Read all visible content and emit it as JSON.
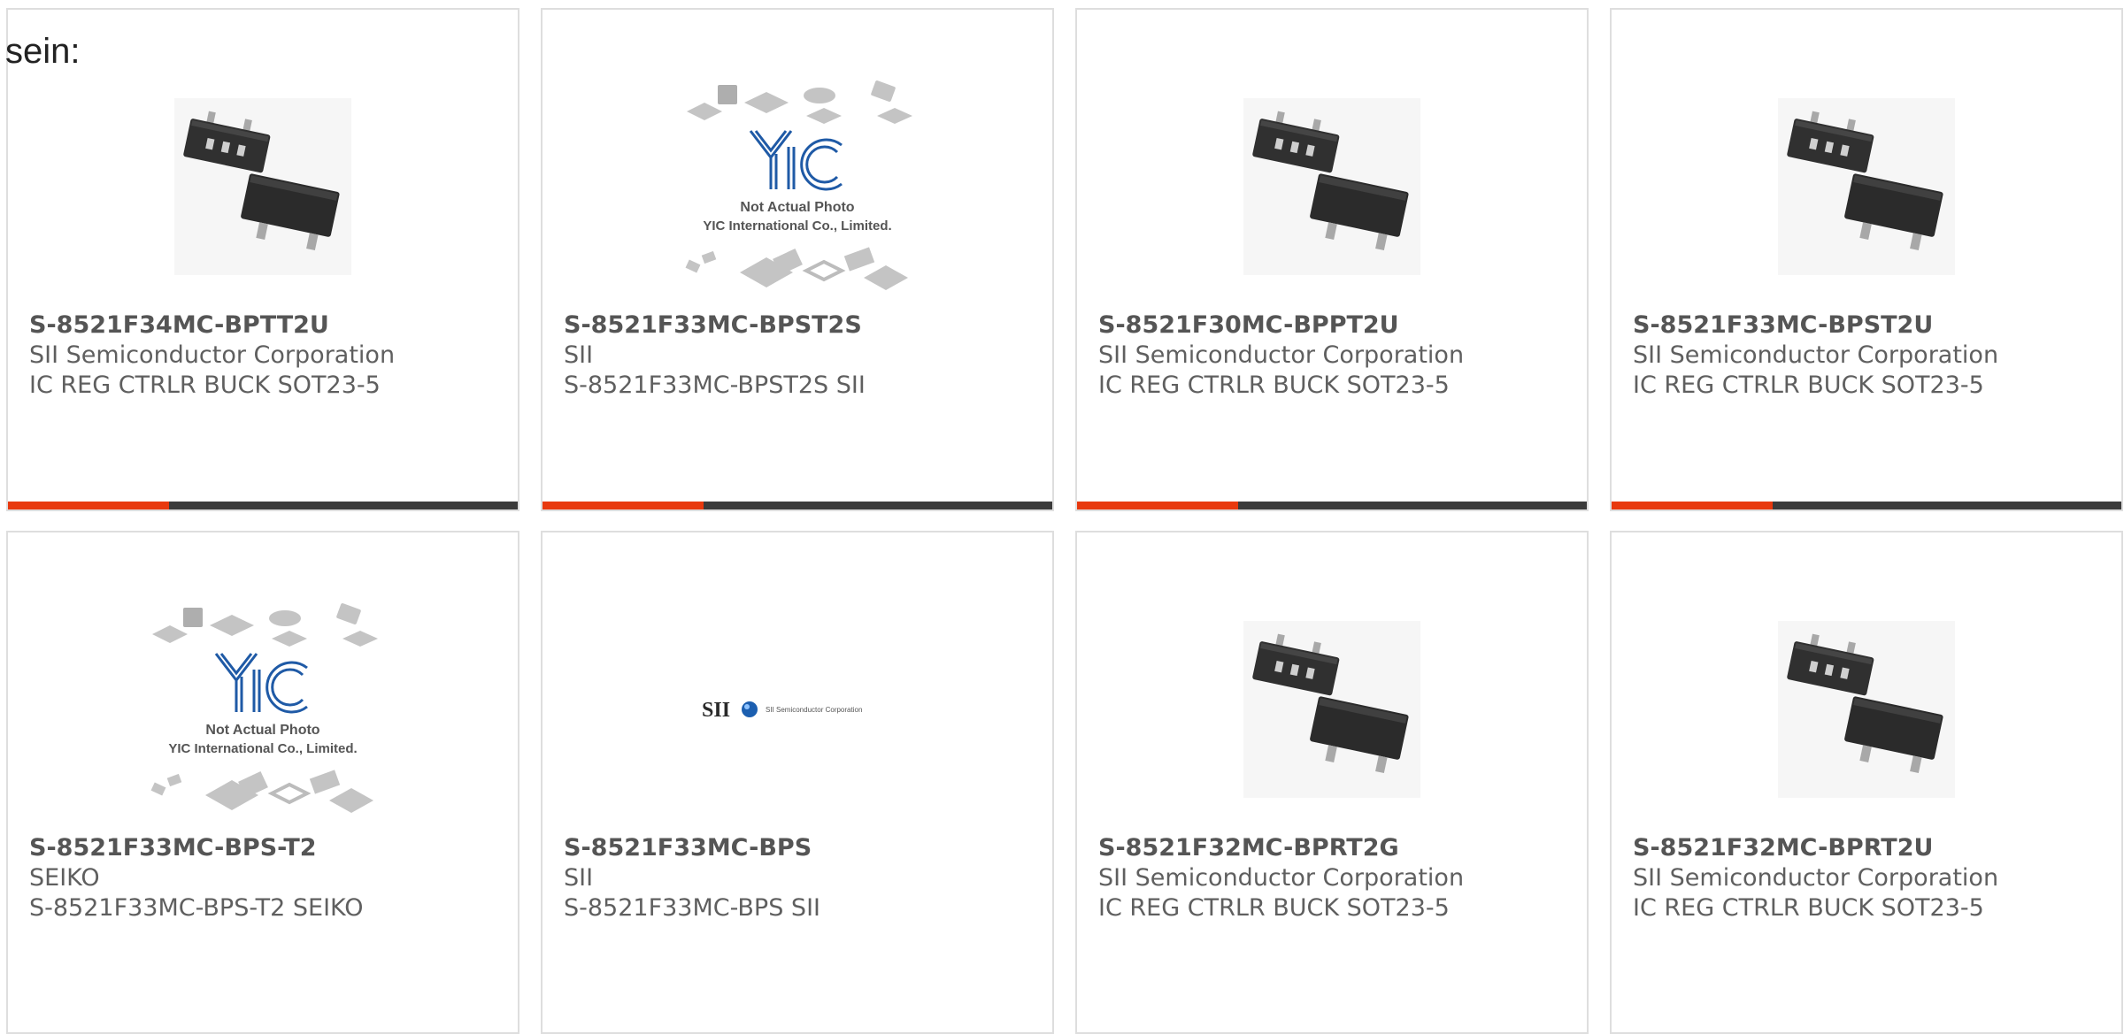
{
  "intro_text": "sein:",
  "colors": {
    "bar_accent": "#e8390e",
    "bar_rest": "#3b3b3b",
    "card_border": "#dedede"
  },
  "yic_placeholder": {
    "line1": "Not Actual Photo",
    "line2": "YIC International Co., Limited."
  },
  "sii_logo": {
    "mark": "SII",
    "company": "SII Semiconductor Corporation"
  },
  "products": [
    {
      "part": "S-8521F34MC-BPTT2U",
      "manufacturer": "SII Semiconductor Corporation",
      "description": "IC REG CTRLR BUCK SOT23-5",
      "image": "sot23-5-package-photo"
    },
    {
      "part": "S-8521F33MC-BPST2S",
      "manufacturer": "SII",
      "description": "S-8521F33MC-BPST2S SII",
      "image": "yic-not-actual-photo"
    },
    {
      "part": "S-8521F30MC-BPPT2U",
      "manufacturer": "SII Semiconductor Corporation",
      "description": "IC REG CTRLR BUCK SOT23-5",
      "image": "sot23-5-package-photo"
    },
    {
      "part": "S-8521F33MC-BPST2U",
      "manufacturer": "SII Semiconductor Corporation",
      "description": "IC REG CTRLR BUCK SOT23-5",
      "image": "sot23-5-package-photo"
    },
    {
      "part": "S-8521F33MC-BPS-T2",
      "manufacturer": "SEIKO",
      "description": "S-8521F33MC-BPS-T2 SEIKO",
      "image": "yic-not-actual-photo"
    },
    {
      "part": "S-8521F33MC-BPS",
      "manufacturer": "SII",
      "description": "S-8521F33MC-BPS SII",
      "image": "sii-logo"
    },
    {
      "part": "S-8521F32MC-BPRT2G",
      "manufacturer": "SII Semiconductor Corporation",
      "description": "IC REG CTRLR BUCK SOT23-5",
      "image": "sot23-5-package-photo"
    },
    {
      "part": "S-8521F32MC-BPRT2U",
      "manufacturer": "SII Semiconductor Corporation",
      "description": "IC REG CTRLR BUCK SOT23-5",
      "image": "sot23-5-package-photo"
    }
  ]
}
